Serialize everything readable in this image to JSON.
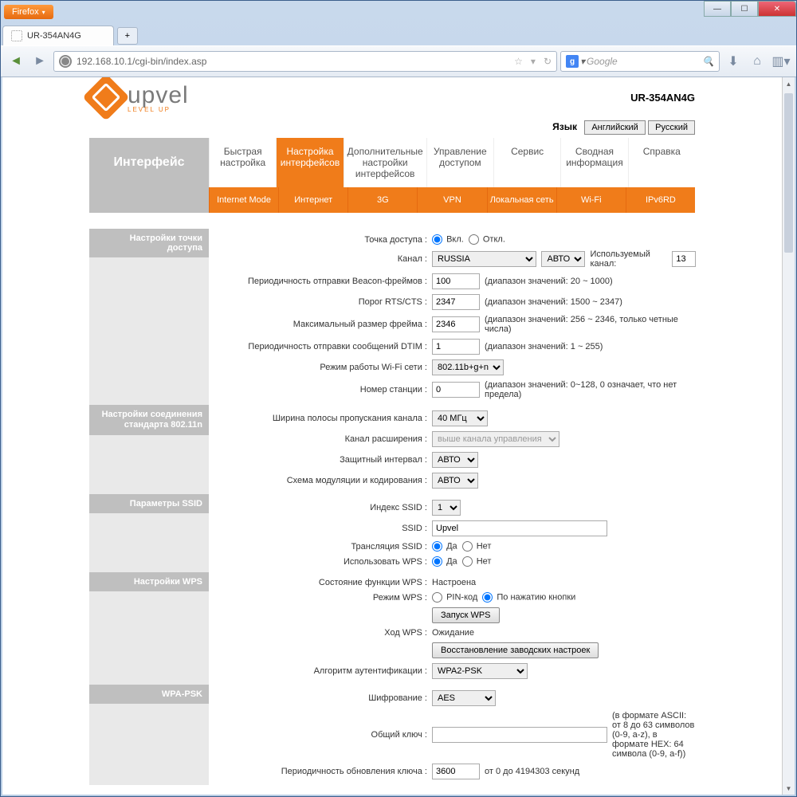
{
  "browser": {
    "app": "Firefox",
    "tab_title": "UR-354AN4G",
    "url": "192.168.10.1/cgi-bin/index.asp",
    "search_placeholder": "Google",
    "new_tab": "+"
  },
  "header": {
    "brand": "upvel",
    "tagline": "LEVEL UP",
    "model": "UR-354AN4G",
    "lang_label": "Язык",
    "lang_en": "Английский",
    "lang_ru": "Русский"
  },
  "sidebar_title": "Интерфейс",
  "topnav": [
    "Быстрая настройка",
    "Настройка интерфейсов",
    "Дополнительные настройки интерфейсов",
    "Управление доступом",
    "Сервис",
    "Сводная информация",
    "Справка"
  ],
  "subnav": [
    "Internet Mode",
    "Интернет",
    "3G",
    "VPN",
    "Локальная сеть",
    "Wi-Fi",
    "IPv6RD"
  ],
  "sections": {
    "ap": "Настройки точки доступа",
    "n80211": "Настройки соединения стандарта 802.11n",
    "ssid": "Параметры SSID",
    "wps": "Настройки WPS",
    "wpapsk": "WPA-PSK"
  },
  "labels": {
    "ap_enable": "Точка доступа",
    "on": "Вкл.",
    "off": "Откл.",
    "channel": "Канал",
    "used_channel": "Используемый канал:",
    "beacon": "Периодичность отправки Beacon-фреймов",
    "rts": "Порог RTS/CTS",
    "frag": "Максимальный размер фрейма",
    "dtim": "Периодичность отправки сообщений DTIM",
    "mode": "Режим работы Wi-Fi сети",
    "station": "Номер станции",
    "bw": "Ширина полосы пропускания канала",
    "ext": "Канал расширения",
    "gi": "Защитный интервал",
    "mcs": "Схема модуляции и кодирования",
    "ssid_idx": "Индекс SSID",
    "ssid": "SSID",
    "bcast": "Трансляция SSID",
    "yes": "Да",
    "no": "Нет",
    "usewps": "Использовать WPS",
    "wps_state": "Состояние функции WPS",
    "wps_mode": "Режим WPS",
    "pin": "PIN-код",
    "pbc": "По нажатию кнопки",
    "start_wps": "Запуск WPS",
    "wps_progress": "Ход WPS",
    "restore": "Восстановление заводских настроек",
    "auth": "Алгоритм аутентификации",
    "cipher": "Шифрование",
    "psk": "Общий ключ",
    "rekey": "Периодичность обновления ключа"
  },
  "values": {
    "country": "RUSSIA",
    "ch_auto": "АВТО",
    "used_channel": "13",
    "beacon": "100",
    "beacon_hint": "(диапазон значений: 20 ~ 1000)",
    "rts": "2347",
    "rts_hint": "(диапазон значений: 1500 ~ 2347)",
    "frag": "2346",
    "frag_hint": "(диапазон значений: 256 ~ 2346, только четные числа)",
    "dtim": "1",
    "dtim_hint": "(диапазон значений: 1 ~ 255)",
    "mode": "802.11b+g+n",
    "station": "0",
    "station_hint": "(диапазон значений: 0~128, 0 означает, что нет предела)",
    "bw": "40 МГц",
    "ext": "выше канала управления",
    "gi": "АВТО",
    "mcs": "АВТО",
    "ssid_idx": "1",
    "ssid": "Upvel",
    "wps_state": "Настроена",
    "wps_progress": "Ожидание",
    "auth": "WPA2-PSK",
    "cipher": "AES",
    "psk": "",
    "psk_hint": "(в формате ASCII: от 8 до 63 символов (0-9, a-z), в формате HEX: 64 символа (0-9, a-f))",
    "rekey": "3600",
    "rekey_hint": "от 0 до 4194303 секунд"
  }
}
